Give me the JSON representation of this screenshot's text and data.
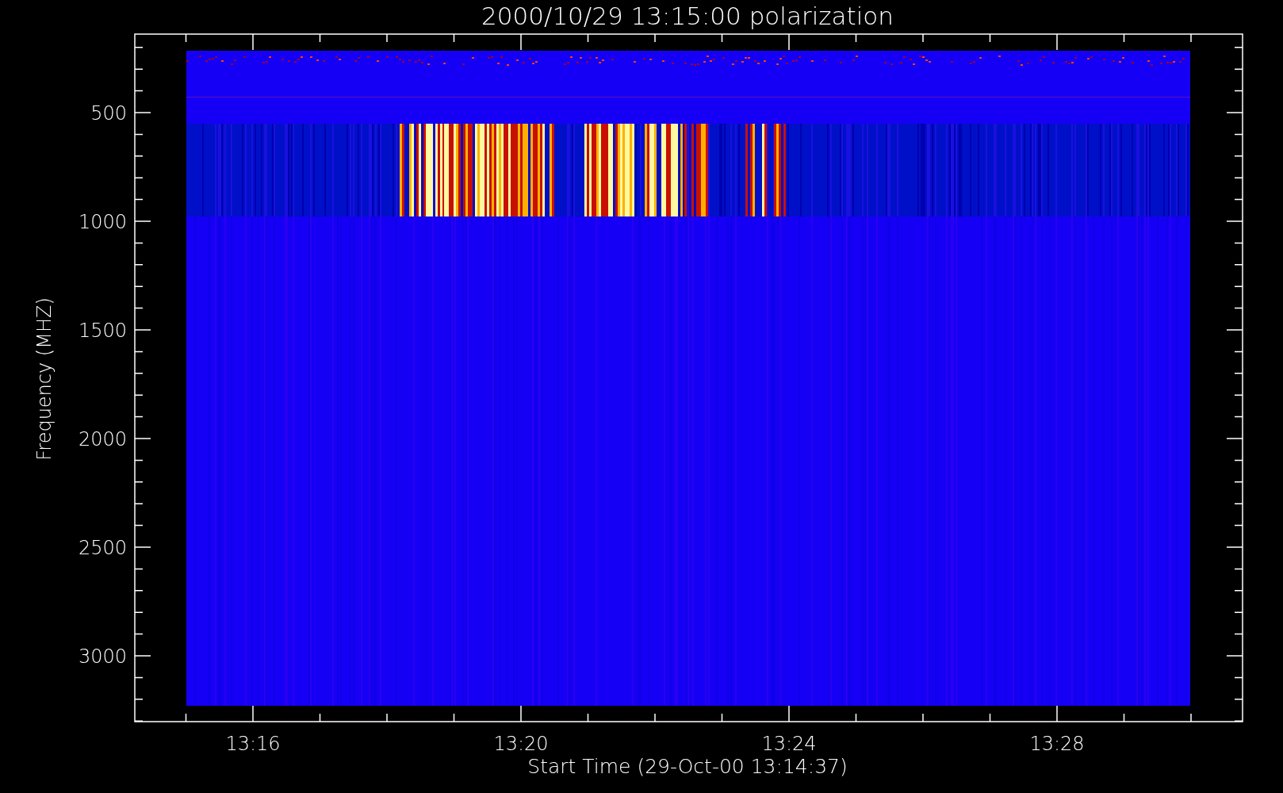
{
  "title": "2000/10/29 13:15:00 polarization",
  "plot": {
    "xlabel": "Start Time (29-Oct-00 13:14:37)",
    "ylabel": "Frequency (MHZ)",
    "xtick_labels": [
      "13:16",
      "13:20",
      "13:24",
      "13:28"
    ],
    "ytick_labels": [
      "500",
      "1000",
      "1500",
      "2000",
      "2500",
      "3000"
    ]
  }
}
